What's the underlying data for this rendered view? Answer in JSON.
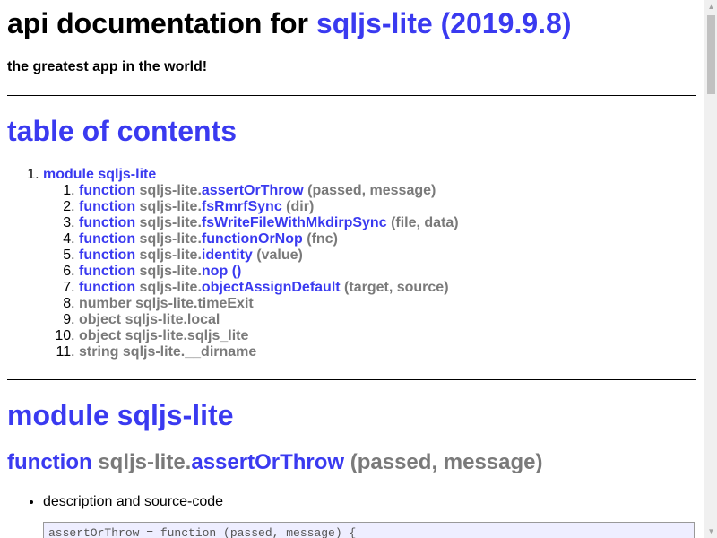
{
  "header": {
    "title_prefix": "api documentation for",
    "title_link": "sqljs-lite (2019.9.8)",
    "subtitle": "the greatest app in the world!"
  },
  "toc": {
    "heading": "table of contents",
    "module_item": "module sqljs-lite",
    "items": [
      {
        "kind": "function",
        "prefix": "sqljs-lite.",
        "name": "assertOrThrow",
        "args": "(passed, message)"
      },
      {
        "kind": "function",
        "prefix": "sqljs-lite.",
        "name": "fsRmrfSync",
        "args": "(dir)"
      },
      {
        "kind": "function",
        "prefix": "sqljs-lite.",
        "name": "fsWriteFileWithMkdirpSync",
        "args": "(file, data)"
      },
      {
        "kind": "function",
        "prefix": "sqljs-lite.",
        "name": "functionOrNop",
        "args": "(fnc)"
      },
      {
        "kind": "function",
        "prefix": "sqljs-lite.",
        "name": "identity",
        "args": "(value)"
      },
      {
        "kind": "function",
        "prefix": "sqljs-lite.",
        "name": "nop",
        "args": "()"
      },
      {
        "kind": "function",
        "prefix": "sqljs-lite.",
        "name": "objectAssignDefault",
        "args": "(target, source)"
      },
      {
        "text": "number sqljs-lite.timeExit"
      },
      {
        "text": "object sqljs-lite.local"
      },
      {
        "text": "object sqljs-lite.sqljs_lite"
      },
      {
        "text": "string sqljs-lite.__dirname"
      }
    ]
  },
  "module": {
    "heading": "module sqljs-lite"
  },
  "function_section": {
    "kind": "function",
    "prefix": "sqljs-lite.",
    "name": "assertOrThrow",
    "args": "(passed, message)",
    "description_label": "description and source-code",
    "code": "assertOrThrow = function (passed, message) {"
  },
  "colors": {
    "link": "#3a3af0",
    "muted": "#7a7a7a",
    "code_bg": "#eeeeff"
  }
}
